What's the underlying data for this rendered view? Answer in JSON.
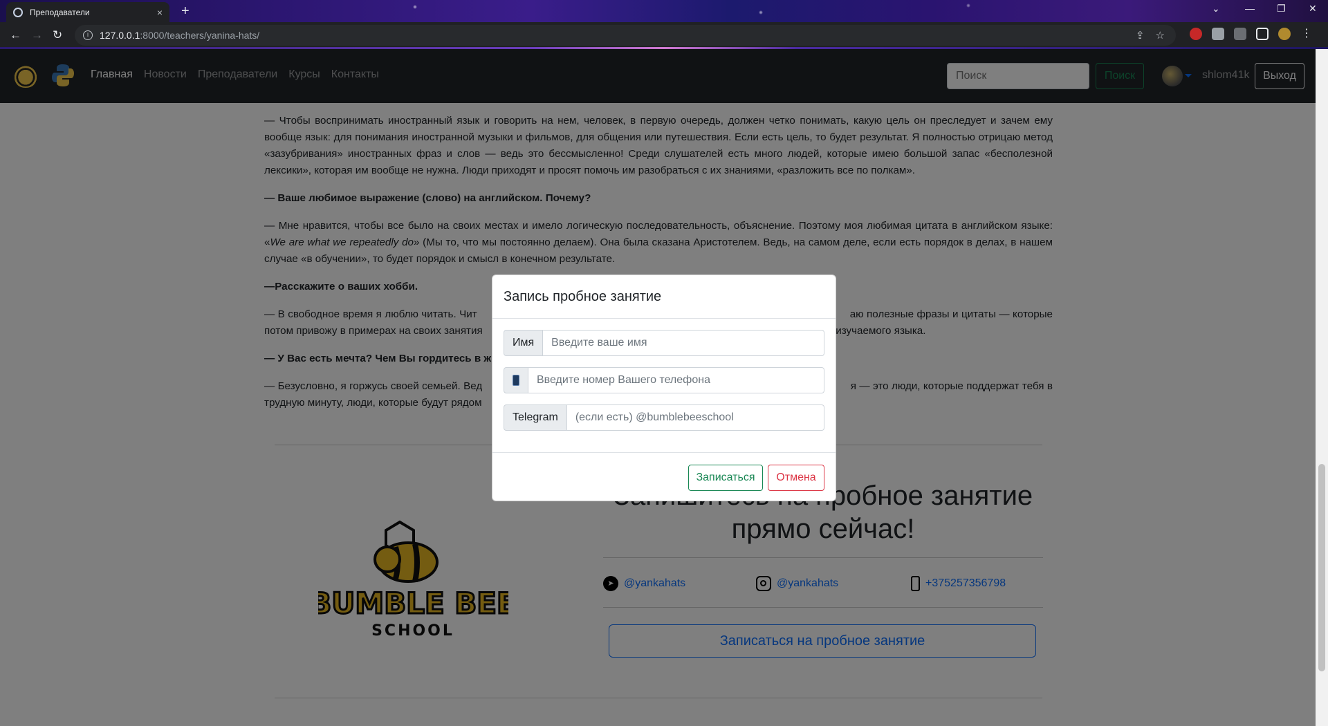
{
  "browser": {
    "tab_title": "Преподаватели",
    "tab_close": "×",
    "new_tab": "+",
    "url_host": "127.0.0.1",
    "url_rest": ":8000/teachers/yanina-hats/",
    "win_minimize": "—",
    "win_restore": "❐",
    "win_close": "✕",
    "win_tabsearch": "⌄"
  },
  "nav": {
    "links": [
      "Главная",
      "Новости",
      "Преподаватели",
      "Курсы",
      "Контакты"
    ],
    "search_placeholder": "Поиск",
    "search_button": "Поиск",
    "username": "shlom41k",
    "logout": "Выход"
  },
  "content": {
    "p1": "— Чтобы воспринимать иностранный язык и говорить на нем, человек, в первую очередь, должен четко понимать, какую цель он преследует и зачем ему вообще язык: для понимания иностранной музыки и фильмов, для общения или путешествия. Если есть цель, то будет результат. Я полностью отрицаю метод «зазубривания» иностранных фраз и слов — ведь это бессмысленно! Среди слушателей есть много людей, которые имею большой запас «бесполезной лексики», которая им вообще не нужна. Люди приходят и просят помочь им разобраться с их знаниями, «разложить все по полкам».",
    "q1": "— Ваше любимое выражение (слово) на английском. Почему?",
    "p2_a": "— Мне нравится, чтобы все было на своих местах и имело логическую последовательность, объяснение.  Поэтому моя любимая цитата в английском языке: «",
    "p2_quote": "We are what we repeatedly do",
    "p2_b": "» (Мы то, что мы постоянно делаем). Она была сказана Аристотелем. Ведь, на самом деле, если есть порядок в делах, в нашем случае «в обучении», то будет порядок и смысл в конечном результате.",
    "q2": "—Расскажите о ваших хобби.",
    "p3": "— В свободное время я люблю читать. Чит                                                                                                                         аю полезные фразы и цитаты — которые потом привожу в примерах на своих занятия                                                                                                                         изучаемого языка.",
    "q3": "— У Вас есть мечта? Чем Вы гордитесь в ж",
    "p4": "— Безусловно, я горжусь своей семьей. Вед                                                                                                                         я — это люди, которые поддержат тебя в трудную минуту, люди, которые будут рядом"
  },
  "cta": {
    "title": "Запишитесь на пробное занятие прямо сейчас!",
    "telegram": "@yankahats",
    "instagram": "@yankahats",
    "phone": "+375257356798",
    "button": "Записаться на пробное занятие"
  },
  "modal": {
    "title": "Запись пробное занятие",
    "name_label": "Имя",
    "name_placeholder": "Введите ваше имя",
    "phone_placeholder": "Введите номер Вашего телефона",
    "telegram_label": "Telegram",
    "telegram_placeholder": "(если есть) @bumblebeeschool",
    "submit": "Записаться",
    "cancel": "Отмена"
  },
  "colors": {
    "navbar_bg": "#212529",
    "success": "#198754",
    "danger": "#dc3545",
    "primary": "#0d6efd"
  }
}
